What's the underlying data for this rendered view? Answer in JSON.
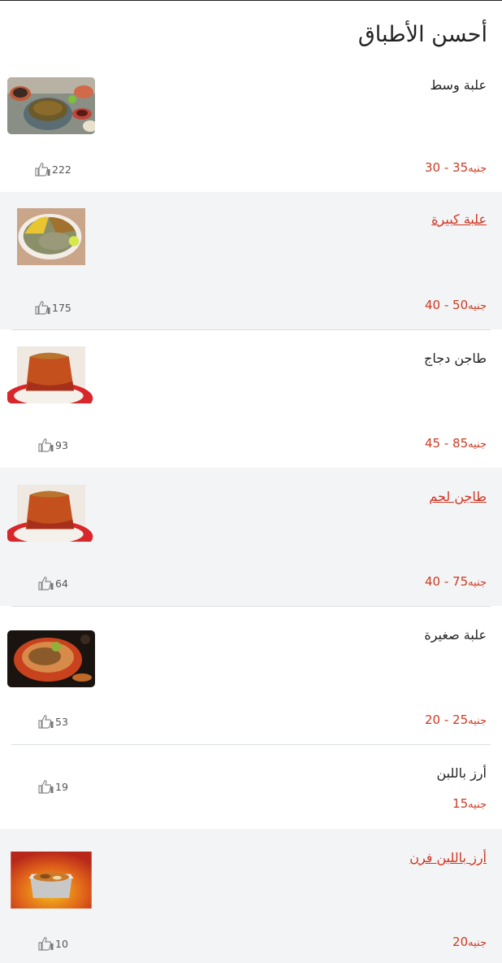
{
  "page": {
    "title": "أحسن الأطباق"
  },
  "dishes": [
    {
      "name": "علبة وسط",
      "price_range": "30 - 35",
      "currency": "جنيه",
      "likes": "222",
      "is_link": false,
      "image": "koshary-middle-box"
    },
    {
      "name": "علبة كبيرة",
      "price_range": "40 - 50",
      "currency": "جنيه",
      "likes": "175",
      "is_link": true,
      "image": "koshary-large-box"
    },
    {
      "name": "طاجن دجاج",
      "price_range": "45 - 85",
      "currency": "جنيه",
      "likes": "93",
      "is_link": false,
      "image": "chicken-tagine"
    },
    {
      "name": "طاجن لحم",
      "price_range": "40 - 75",
      "currency": "جنيه",
      "likes": "64",
      "is_link": true,
      "image": "meat-tagine"
    },
    {
      "name": "علبة صغيرة",
      "price_range": "20 - 25",
      "currency": "جنيه",
      "likes": "53",
      "is_link": false,
      "image": "koshary-small-box"
    },
    {
      "name": "أرز باللبن",
      "price_range": "15",
      "currency": "جنيه",
      "likes": "19",
      "is_link": false,
      "image": null
    },
    {
      "name": "أرز باللبن فرن",
      "price_range": "20",
      "currency": "جنيه",
      "likes": "10",
      "is_link": true,
      "image": "baked-rice-pudding"
    }
  ],
  "colors": {
    "price": "#cc3b22",
    "link": "#d0341f",
    "shaded_row": "#f2f4f6"
  },
  "icons": {
    "likes": "thumbs-up-icon"
  }
}
